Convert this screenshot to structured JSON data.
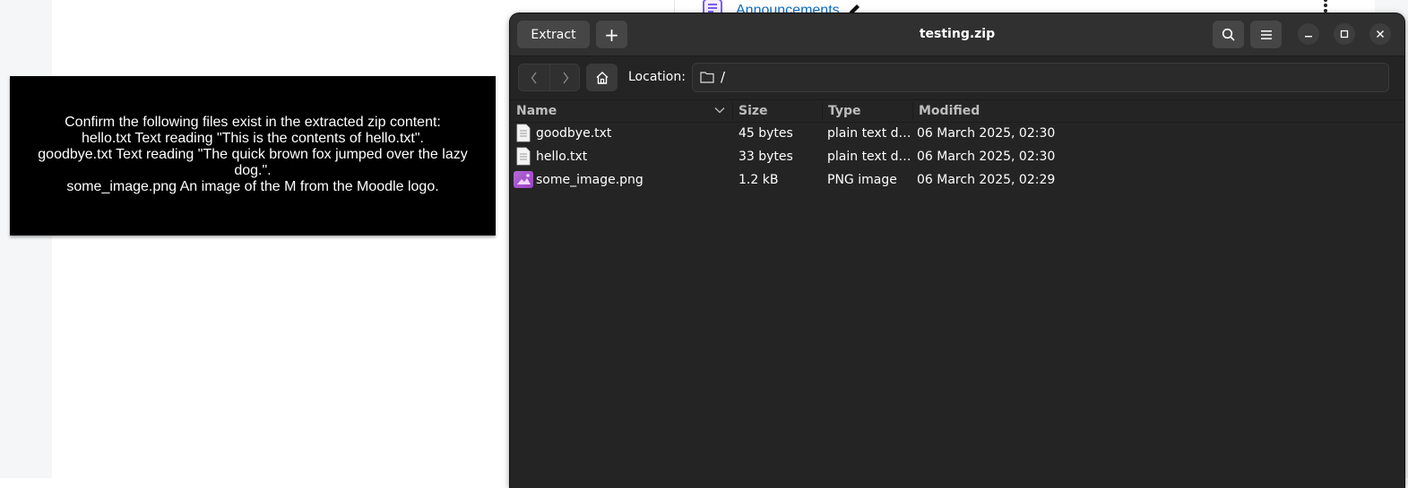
{
  "background_page": {
    "announcements_link": "Announcements"
  },
  "instructions": {
    "lines": [
      "Confirm the following files exist in the extracted zip content:",
      "hello.txt Text reading \"This is the contents of hello.txt\".",
      "goodbye.txt Text reading \"The quick brown fox jumped over the lazy",
      "dog.\".",
      "some_image.png An image of the M from the Moodle logo."
    ]
  },
  "window": {
    "title": "testing.zip",
    "extract_label": "Extract",
    "add_label": "+",
    "location_label": "Location:",
    "location_path": "/"
  },
  "columns": {
    "name": "Name",
    "size": "Size",
    "type": "Type",
    "modified": "Modified"
  },
  "files": [
    {
      "name": "goodbye.txt",
      "size": "45 bytes",
      "type": "plain text d…",
      "modified": "06 March 2025, 02:30",
      "icon": "text-file-icon"
    },
    {
      "name": "hello.txt",
      "size": "33 bytes",
      "type": "plain text d…",
      "modified": "06 March 2025, 02:30",
      "icon": "text-file-icon"
    },
    {
      "name": "some_image.png",
      "size": "1.2 kB",
      "type": "PNG image",
      "modified": "06 March 2025, 02:29",
      "icon": "image-file-icon"
    }
  ],
  "colors": {
    "window_bg": "#242424",
    "headerbar_bg": "#303030",
    "link_blue": "#0f6cbf",
    "accent_purple": "#7b5cf0"
  }
}
